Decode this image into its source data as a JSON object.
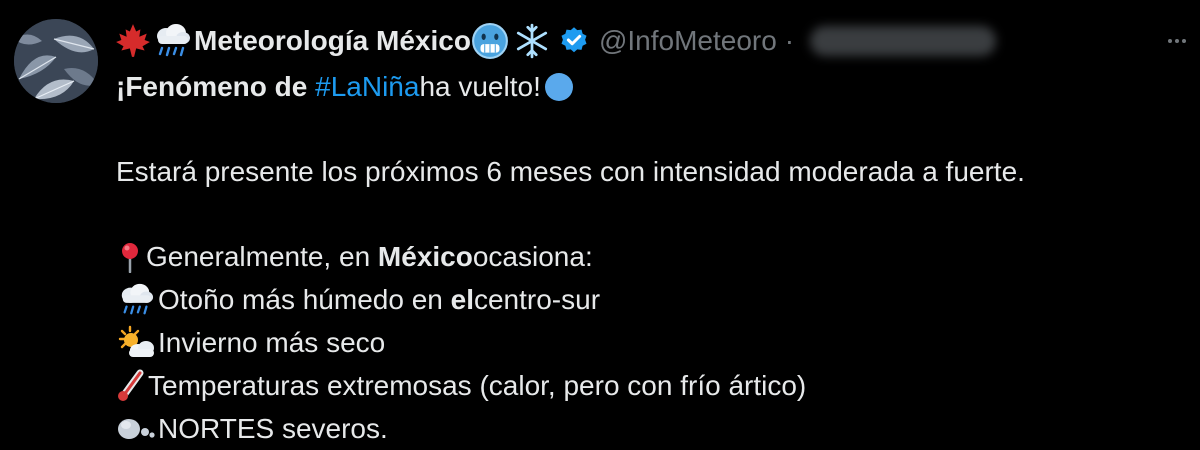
{
  "tweet": {
    "author": {
      "display_name": "Meteorología México",
      "handle": "@InfoMeteoro",
      "separator": "·",
      "name_emojis_before": [
        "maple-leaf",
        "cloud-with-rain"
      ],
      "name_emojis_after": [
        "cold-face",
        "snowflake"
      ],
      "verified": true
    },
    "body": {
      "line1_bold": "¡Fenómeno de ",
      "hashtag": "#LaNiña",
      "line1_rest": " ha vuelto!",
      "line1_emoji": "blue-circle",
      "line2": "Estará presente los próximos 6 meses con intensidad moderada a fuerte.",
      "line3_pre": " Generalmente, en ",
      "line3_bold": "México",
      "line3_post": " ocasiona:",
      "line4_pre": "Otoño más húmedo en ",
      "line4_bold": "el",
      "line4_post": " centro-sur",
      "line5": "Invierno más seco",
      "line6": " Temperaturas extremosas (calor, pero con frío ártico)",
      "line7": "NORTES severos."
    }
  },
  "colors": {
    "background": "#000000",
    "text": "#e7e9ea",
    "secondary": "#71767b",
    "link": "#1d9bf0"
  }
}
